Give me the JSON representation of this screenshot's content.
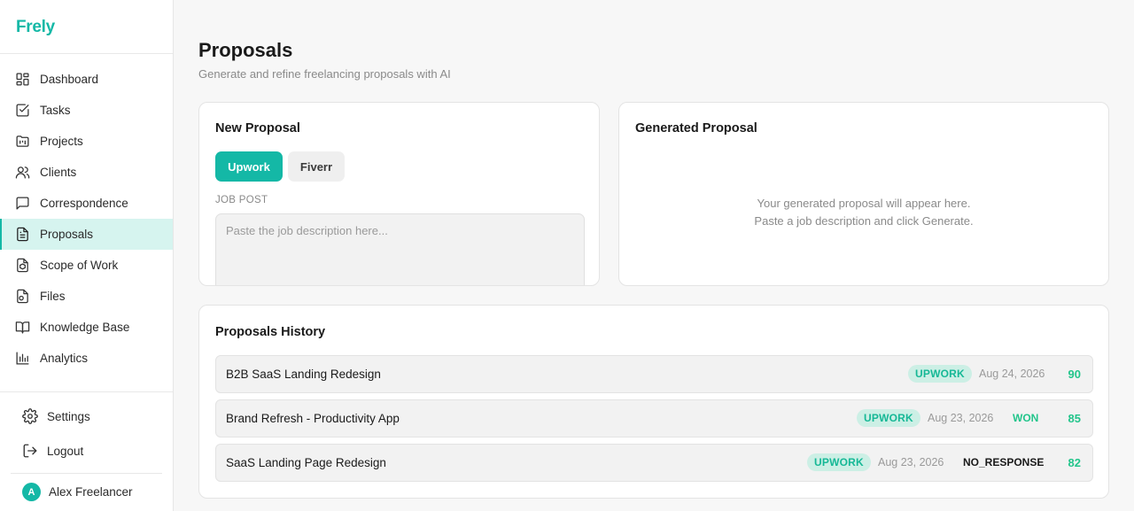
{
  "app": {
    "brand": "Frely"
  },
  "sidebar": {
    "items": [
      {
        "label": "Dashboard",
        "icon": "dashboard-icon",
        "active": false
      },
      {
        "label": "Tasks",
        "icon": "tasks-icon",
        "active": false
      },
      {
        "label": "Projects",
        "icon": "projects-icon",
        "active": false
      },
      {
        "label": "Clients",
        "icon": "clients-icon",
        "active": false
      },
      {
        "label": "Correspondence",
        "icon": "message-icon",
        "active": false
      },
      {
        "label": "Proposals",
        "icon": "document-icon",
        "active": true
      },
      {
        "label": "Scope of Work",
        "icon": "scope-icon",
        "active": false
      },
      {
        "label": "Files",
        "icon": "files-icon",
        "active": false
      },
      {
        "label": "Knowledge Base",
        "icon": "book-icon",
        "active": false
      },
      {
        "label": "Analytics",
        "icon": "chart-icon",
        "active": false
      }
    ],
    "settings_label": "Settings",
    "logout_label": "Logout",
    "user": {
      "initial": "A",
      "name": "Alex Freelancer"
    }
  },
  "page": {
    "title": "Proposals",
    "subtitle": "Generate and refine freelancing proposals with AI"
  },
  "new_proposal": {
    "title": "New Proposal",
    "tabs": [
      {
        "label": "Upwork",
        "active": true
      },
      {
        "label": "Fiverr",
        "active": false
      }
    ],
    "job_post_label": "JOB POST",
    "job_post_placeholder": "Paste the job description here...",
    "job_post_value": ""
  },
  "generated": {
    "title": "Generated Proposal",
    "empty_line1": "Your generated proposal will appear here.",
    "empty_line2": "Paste a job description and click Generate."
  },
  "history": {
    "title": "Proposals History",
    "rows": [
      {
        "title": "B2B SaaS Landing Redesign",
        "platform": "UPWORK",
        "date": "Aug 24, 2026",
        "status": "",
        "score": "90"
      },
      {
        "title": "Brand Refresh - Productivity App",
        "platform": "UPWORK",
        "date": "Aug 23, 2026",
        "status": "WON",
        "score": "85"
      },
      {
        "title": "SaaS Landing Page Redesign",
        "platform": "UPWORK",
        "date": "Aug 23, 2026",
        "status": "NO_RESPONSE",
        "score": "82"
      }
    ]
  },
  "colors": {
    "accent": "#14b8a6",
    "active_bg": "#d6f4ef",
    "badge_bg": "#ccefe5",
    "score": "#22c58b",
    "won": "#22c58b",
    "no_response": "#1a1a1a"
  }
}
